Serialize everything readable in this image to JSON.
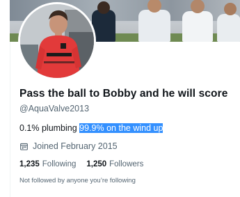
{
  "profile": {
    "display_name": "Pass the ball to Bobby and he will score",
    "handle": "@AquaValve2013",
    "bio_plain": "0.1% plumbing ",
    "bio_selected": "99.9% on the wind up",
    "joined": "Joined February 2015",
    "joined_icon": "calendar-icon",
    "following_count": "1,235",
    "following_label": "Following",
    "followers_count": "1,250",
    "followers_label": "Followers",
    "not_followed_text": "Not followed by anyone you’re following"
  },
  "colors": {
    "text_primary": "#0f1419",
    "text_secondary": "#536471",
    "selection_highlight": "#3390ff"
  }
}
